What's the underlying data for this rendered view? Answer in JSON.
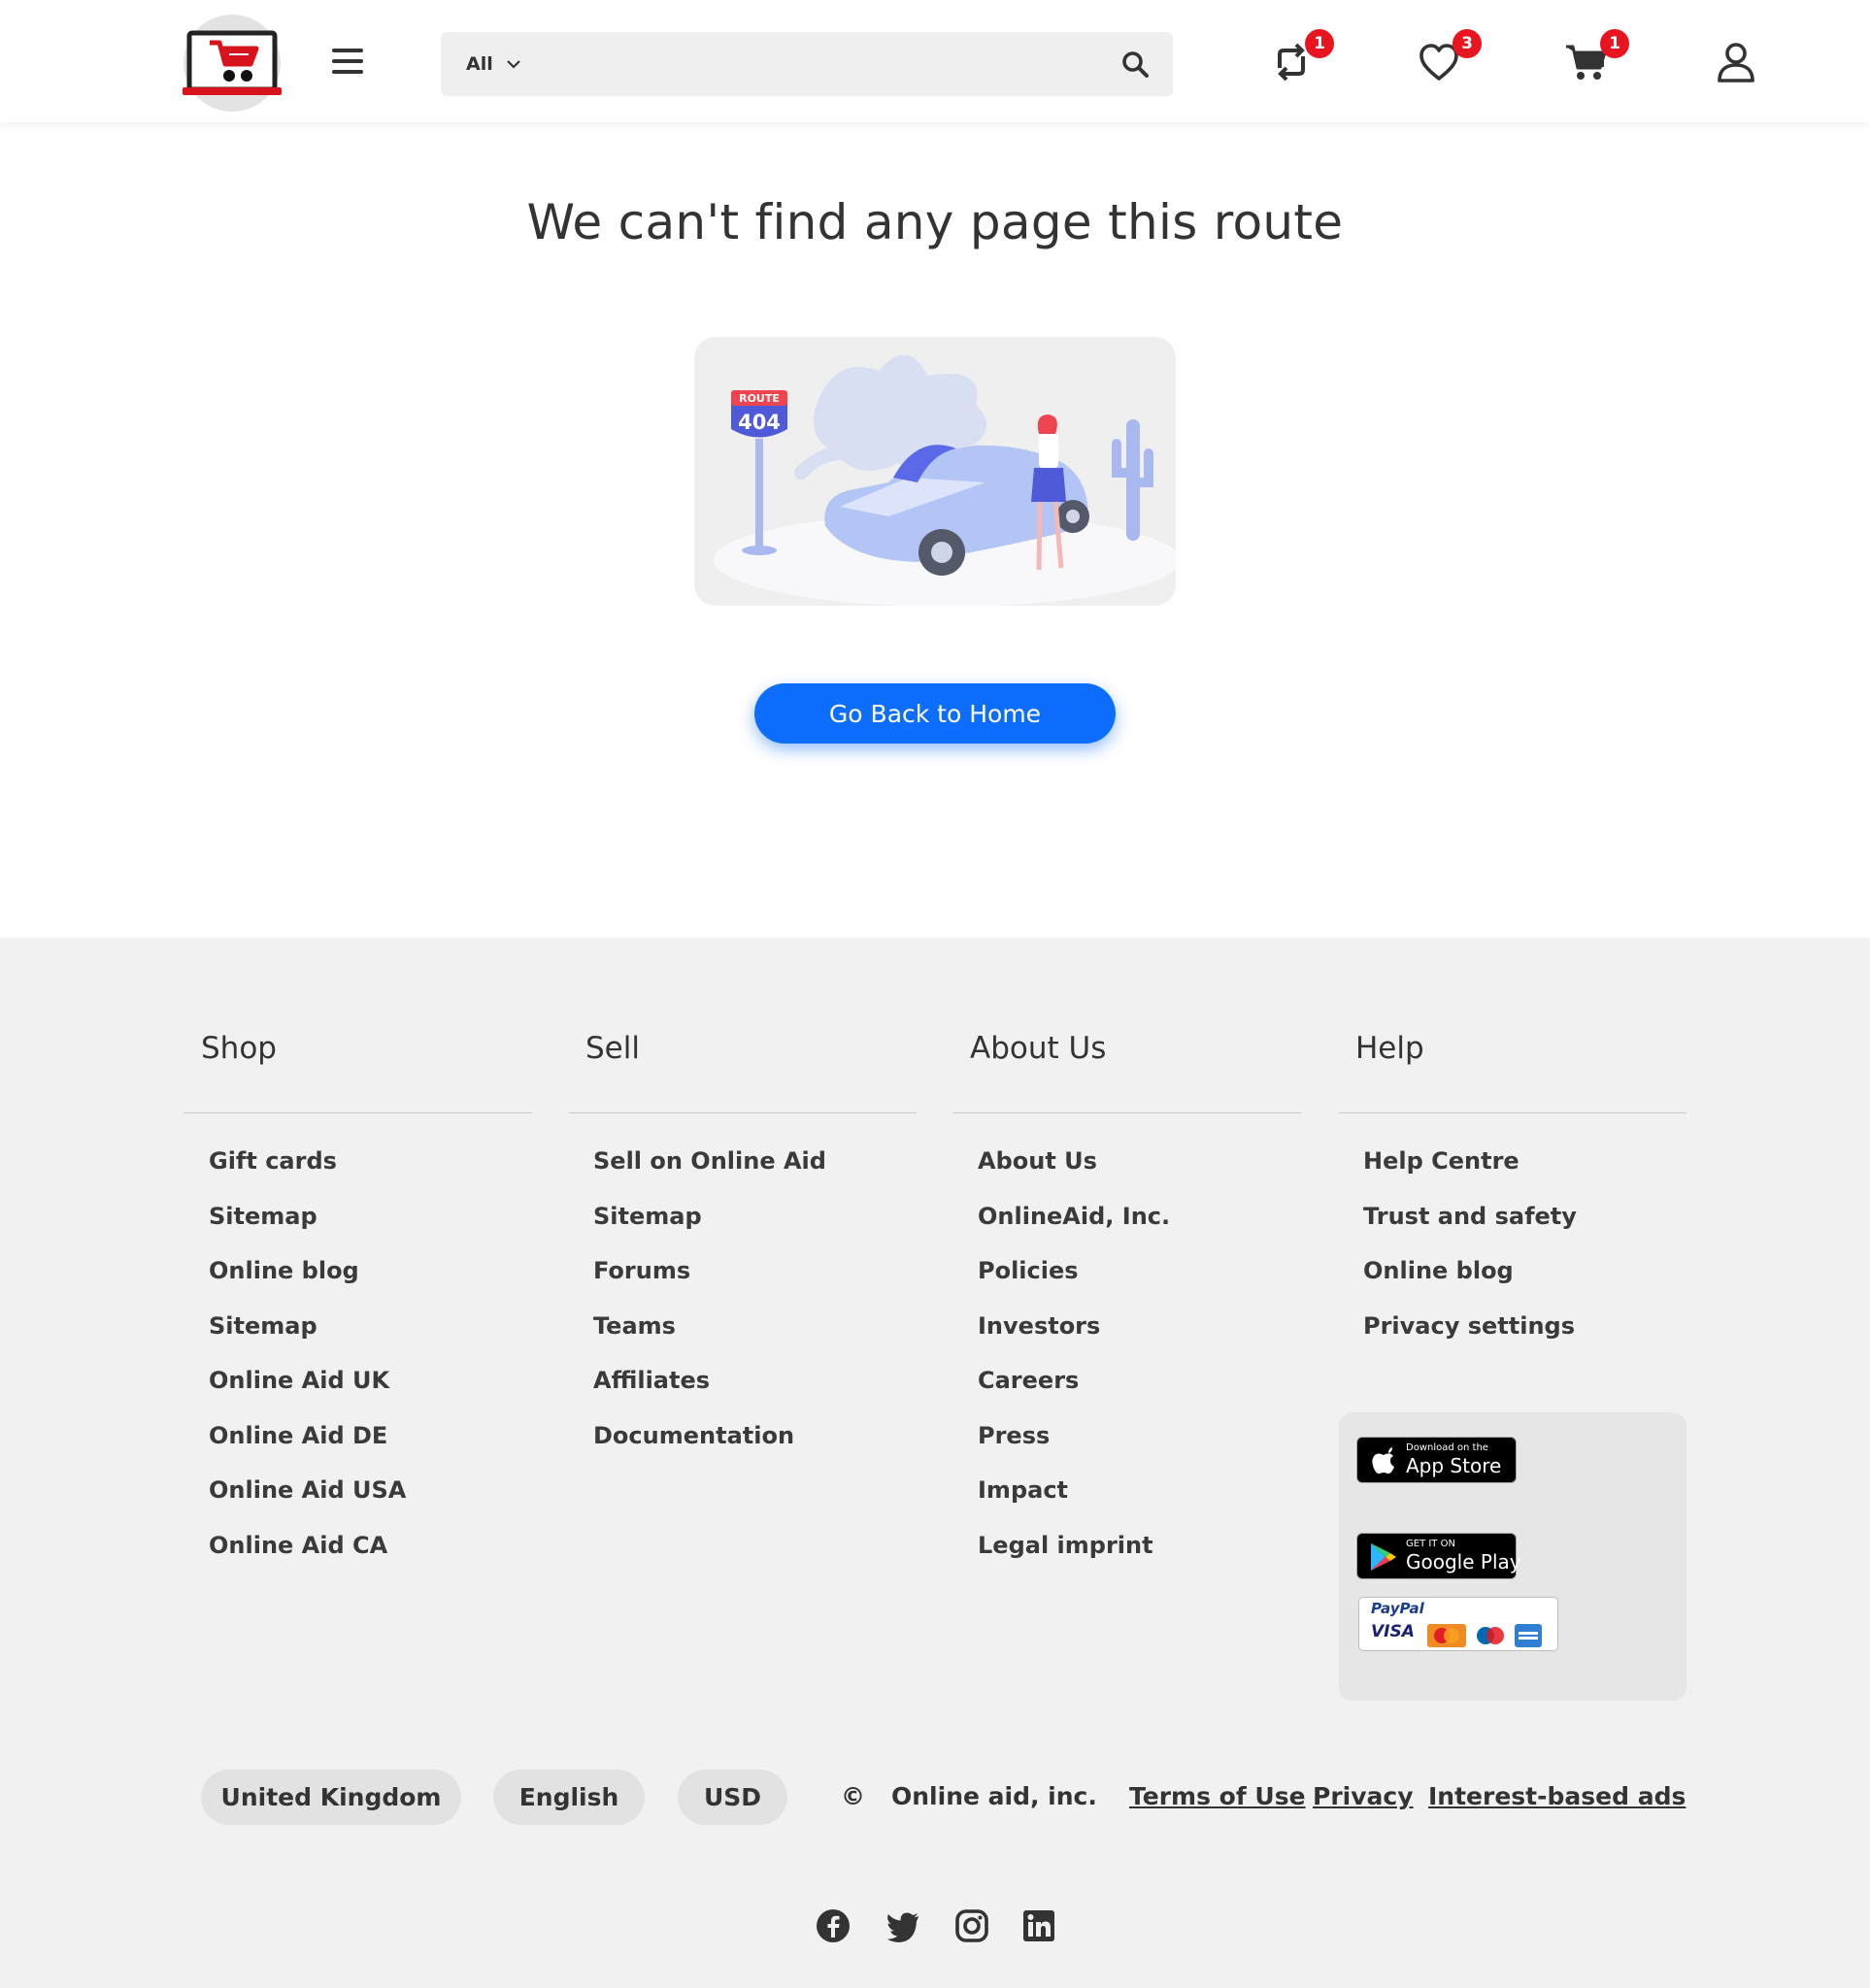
{
  "header": {
    "search": {
      "category": "All",
      "placeholder": ""
    },
    "badges": {
      "compare": "1",
      "wishlist": "3",
      "cart": "1"
    }
  },
  "main": {
    "title": "We can't find any page this route",
    "illustration": {
      "sign_top": "ROUTE",
      "sign_number": "404"
    },
    "home_button": "Go Back to Home"
  },
  "footer": {
    "columns": [
      {
        "heading": "Shop",
        "links": [
          "Gift cards",
          "Sitemap",
          "Online blog",
          "Sitemap",
          "Online Aid UK",
          "Online Aid DE",
          "Online Aid USA",
          "Online Aid CA"
        ]
      },
      {
        "heading": "Sell",
        "links": [
          "Sell on Online Aid",
          "Sitemap",
          "Forums",
          "Teams",
          "Affiliates",
          "Documentation"
        ]
      },
      {
        "heading": "About Us",
        "links": [
          "About Us",
          "OnlineAid, Inc.",
          "Policies",
          "Investors",
          "Careers",
          "Press",
          "Impact",
          "Legal imprint"
        ]
      },
      {
        "heading": "Help",
        "links": [
          "Help Centre",
          "Trust and safety",
          "Online blog",
          "Privacy settings"
        ]
      }
    ],
    "apps": {
      "app_store": {
        "small": "Download on the",
        "big": "App Store"
      },
      "google_play": {
        "small": "GET IT ON",
        "big": "Google Play"
      },
      "payments": {
        "paypal": "PayPal",
        "visa": "VISA"
      }
    },
    "bottom": {
      "country": "United Kingdom",
      "language": "English",
      "currency": "USD",
      "copyright_symbol": "©",
      "company": "Online aid, inc.",
      "links": [
        "Terms of Use",
        "Privacy",
        "Interest-based ads"
      ]
    },
    "social": [
      "facebook-icon",
      "twitter-icon",
      "instagram-icon",
      "linkedin-icon"
    ]
  },
  "colors": {
    "accent": "#0d6efd",
    "badge": "#e8141f",
    "footer_bg": "#f1f1f1",
    "text": "#333333"
  }
}
